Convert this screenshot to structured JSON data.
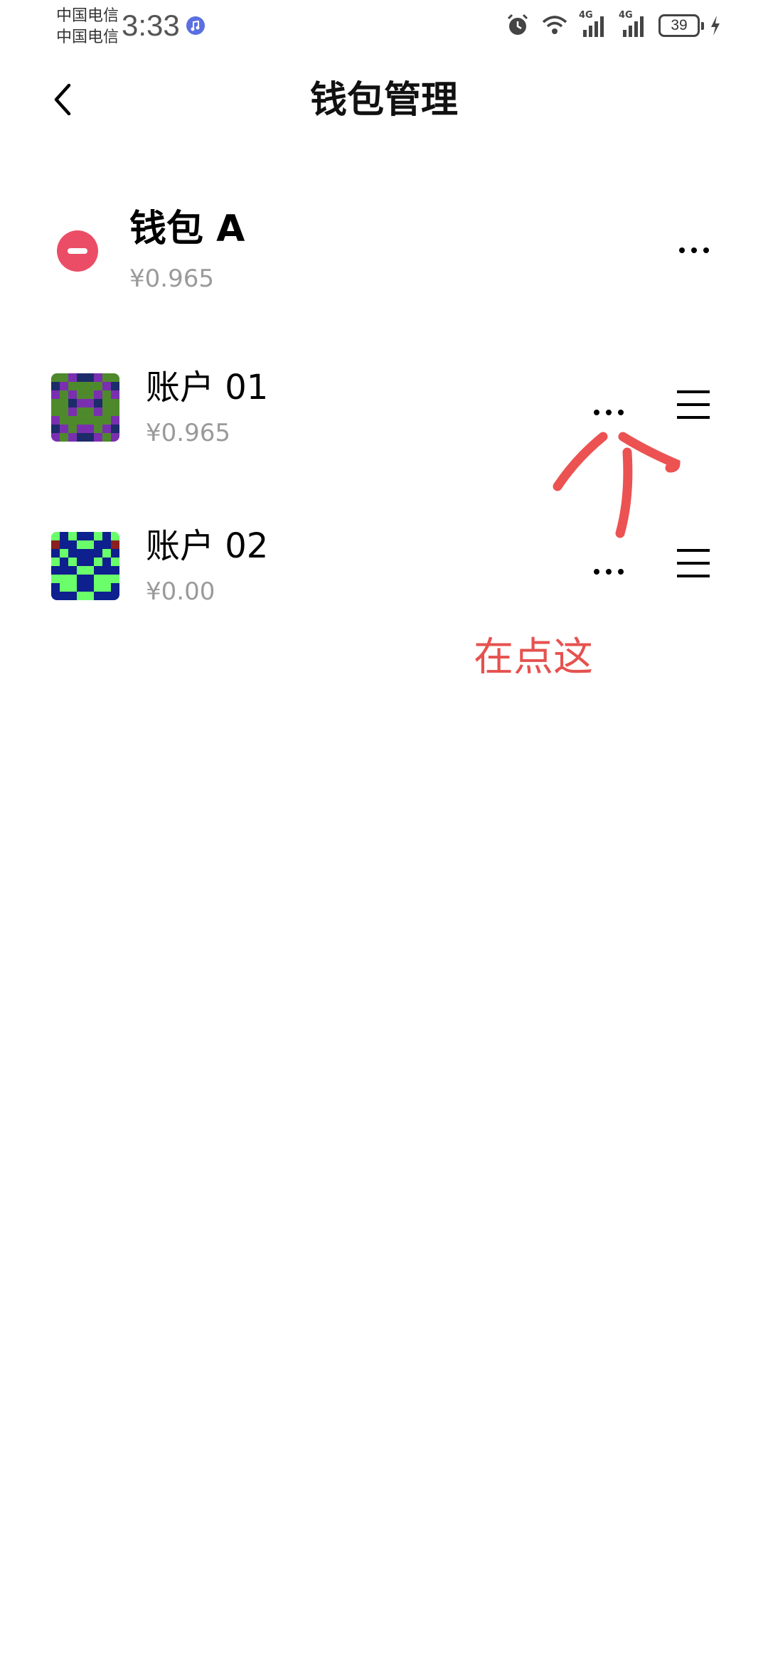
{
  "status_bar": {
    "carrier_1": "中国电信",
    "carrier_2": "中国电信",
    "time": "3:33",
    "network_1": "4G",
    "network_2": "4G",
    "battery": "39",
    "icons": [
      "music-icon",
      "alarm-icon",
      "wifi-icon",
      "signal-icon",
      "signal-icon",
      "battery-icon",
      "charging-icon"
    ]
  },
  "header": {
    "title": "钱包管理"
  },
  "wallet": {
    "name": "钱包 A",
    "balance": "¥0.965"
  },
  "accounts": [
    {
      "name": "账户 01",
      "balance": "¥0.965"
    },
    {
      "name": "账户 02",
      "balance": "¥0.00"
    }
  ],
  "annotation": {
    "text": "在点这",
    "color": "#e5524f"
  },
  "colors": {
    "remove": "#ec4d66",
    "secondary_text": "#9a9a9a",
    "annotation": "#e5524f"
  }
}
